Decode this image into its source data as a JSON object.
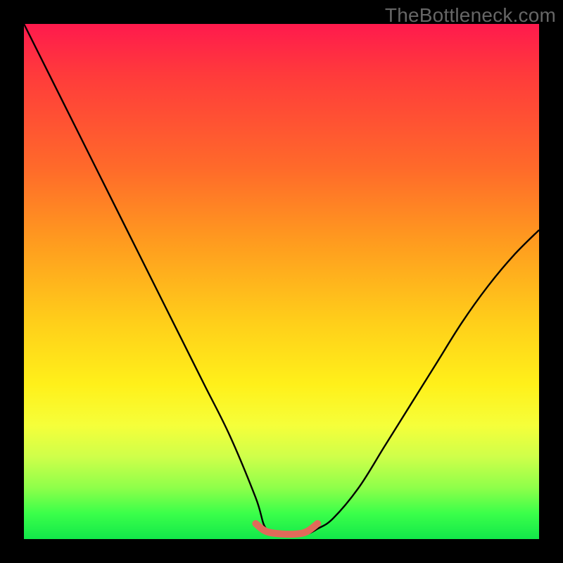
{
  "watermark": "TheBottleneck.com",
  "chart_data": {
    "type": "line",
    "title": "",
    "xlabel": "",
    "ylabel": "",
    "xlim": [
      0,
      100
    ],
    "ylim": [
      0,
      100
    ],
    "grid": false,
    "legend": false,
    "series": [
      {
        "name": "bottleneck-curve",
        "color": "#000000",
        "x": [
          0,
          5,
          10,
          15,
          20,
          25,
          30,
          35,
          40,
          45,
          47,
          50,
          53,
          55,
          57,
          60,
          65,
          70,
          75,
          80,
          85,
          90,
          95,
          100
        ],
        "y": [
          100,
          90,
          80,
          70,
          60,
          50,
          40,
          30,
          20,
          8,
          2,
          1,
          1,
          1,
          2,
          4,
          10,
          18,
          26,
          34,
          42,
          49,
          55,
          60
        ]
      },
      {
        "name": "optimal-range-marker",
        "color": "#e06a5a",
        "x": [
          45,
          47,
          50,
          53,
          55,
          57
        ],
        "y": [
          3,
          1.5,
          1,
          1,
          1.5,
          3
        ]
      }
    ],
    "gradient_stops": [
      {
        "pos": 0,
        "color": "#ff1a4d"
      },
      {
        "pos": 28,
        "color": "#ff6a2a"
      },
      {
        "pos": 58,
        "color": "#ffcf1a"
      },
      {
        "pos": 78,
        "color": "#f5ff3a"
      },
      {
        "pos": 95,
        "color": "#3bff4a"
      },
      {
        "pos": 100,
        "color": "#12e84a"
      }
    ]
  }
}
